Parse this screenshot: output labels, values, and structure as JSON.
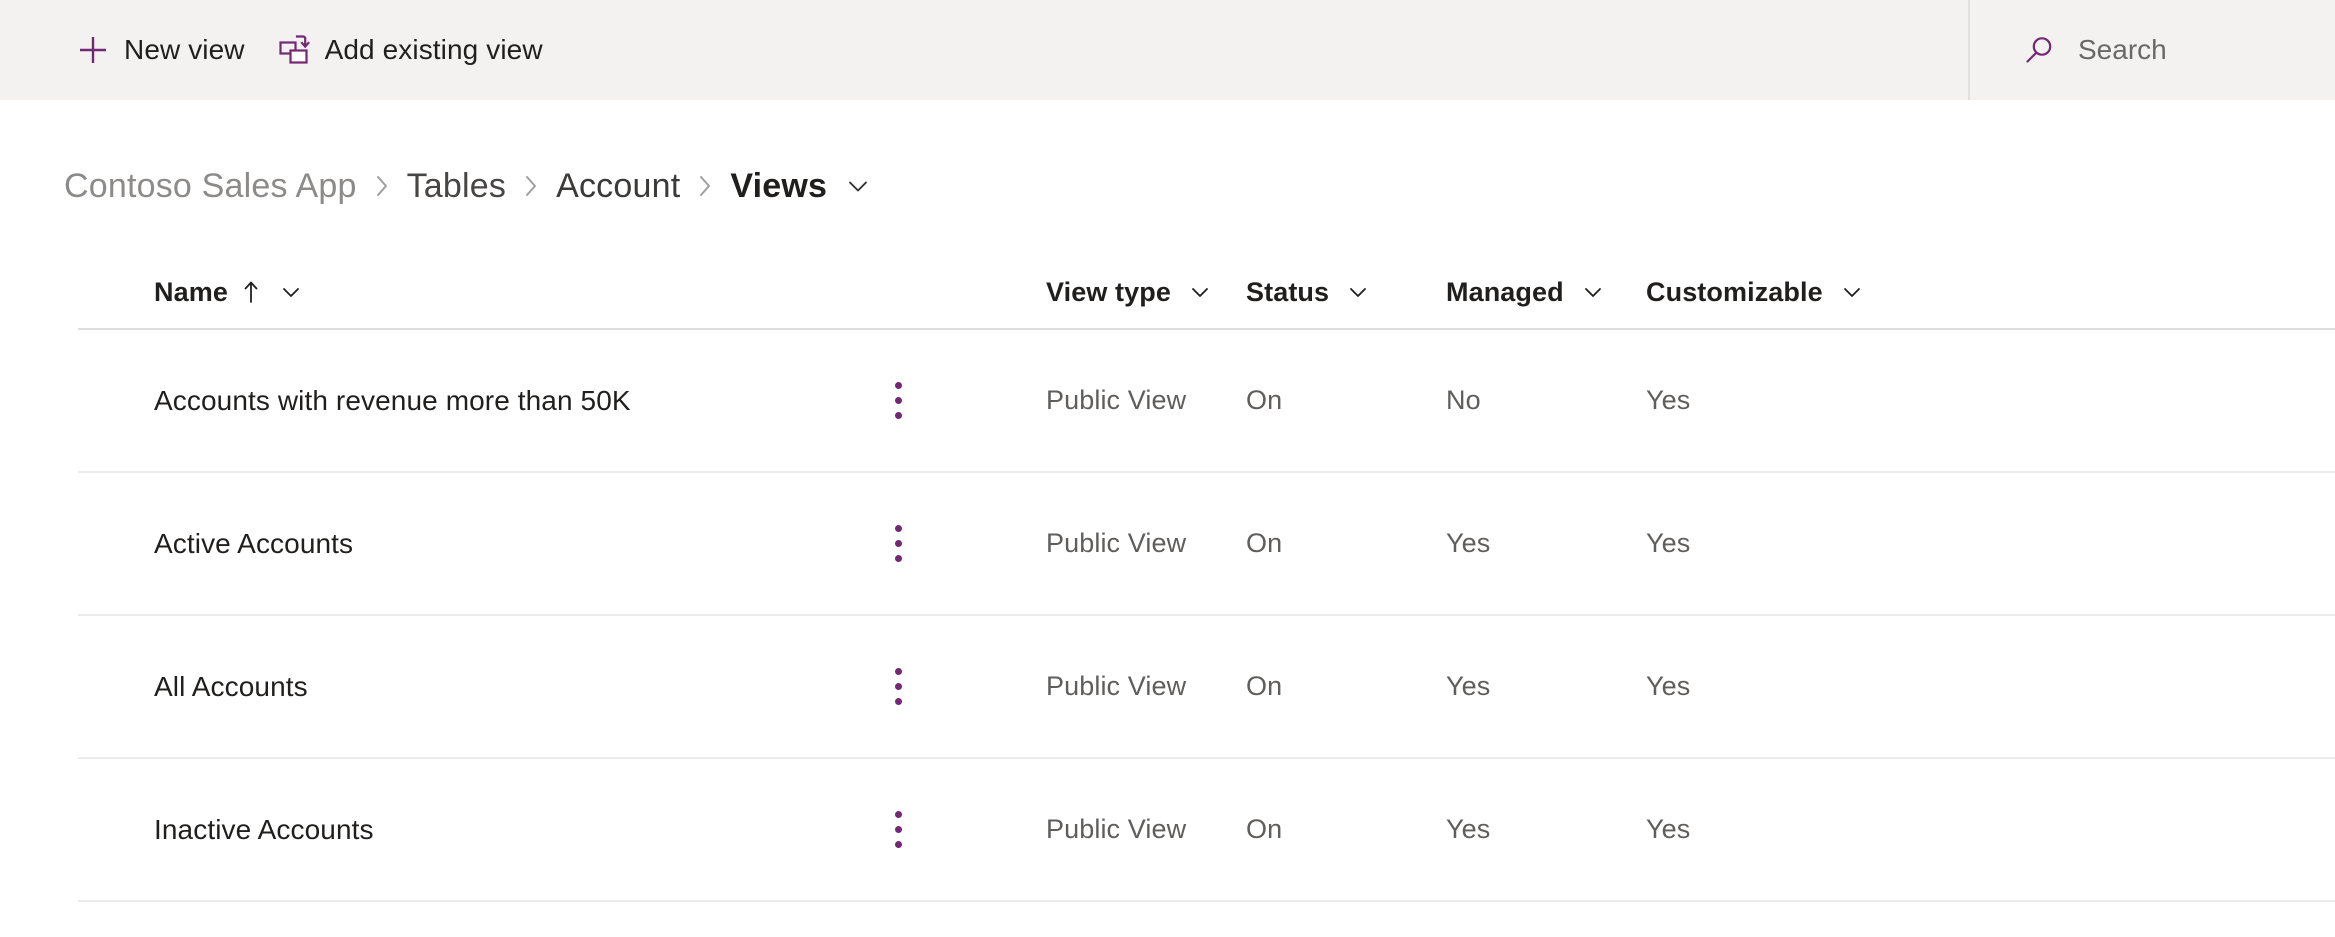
{
  "theme": {
    "accent_purple": "#742774",
    "command_bar_bg": "#f3f2f1",
    "page_bg": "#ffffff",
    "row_divider": "#edebe9",
    "text_primary": "#201f1e",
    "text_secondary": "#605e5c",
    "text_muted": "#8d8b89"
  },
  "command_bar": {
    "buttons": [
      {
        "id": "new-view",
        "label": "New view",
        "icon": "plus-icon"
      },
      {
        "id": "add-existing-view",
        "label": "Add existing view",
        "icon": "add-existing-view-icon"
      }
    ],
    "search": {
      "placeholder": "Search",
      "value": "",
      "icon": "search-icon"
    }
  },
  "breadcrumb": {
    "separator": "›",
    "items": [
      {
        "label": "Contoso Sales App",
        "current": false
      },
      {
        "label": "Tables",
        "current": false
      },
      {
        "label": "Account",
        "current": false
      },
      {
        "label": "Views",
        "current": true
      }
    ],
    "caret_icon": "chevron-down-icon"
  },
  "table": {
    "columns": [
      {
        "key": "name",
        "label": "Name",
        "sorted": "ascending",
        "sort_icon": "arrow-up-icon",
        "caret_icon": "chevron-down-icon"
      },
      {
        "key": "view_type",
        "label": "View type",
        "caret_icon": "chevron-down-icon"
      },
      {
        "key": "status",
        "label": "Status",
        "caret_icon": "chevron-down-icon"
      },
      {
        "key": "managed",
        "label": "Managed",
        "caret_icon": "chevron-down-icon"
      },
      {
        "key": "customizable",
        "label": "Customizable",
        "caret_icon": "chevron-down-icon"
      }
    ],
    "row_menu_icon": "more-vertical-icon",
    "rows": [
      {
        "name": "Accounts with revenue more than 50K",
        "view_type": "Public View",
        "status": "On",
        "managed": "No",
        "customizable": "Yes"
      },
      {
        "name": "Active Accounts",
        "view_type": "Public View",
        "status": "On",
        "managed": "Yes",
        "customizable": "Yes"
      },
      {
        "name": "All Accounts",
        "view_type": "Public View",
        "status": "On",
        "managed": "Yes",
        "customizable": "Yes"
      },
      {
        "name": "Inactive Accounts",
        "view_type": "Public View",
        "status": "On",
        "managed": "Yes",
        "customizable": "Yes"
      }
    ]
  }
}
